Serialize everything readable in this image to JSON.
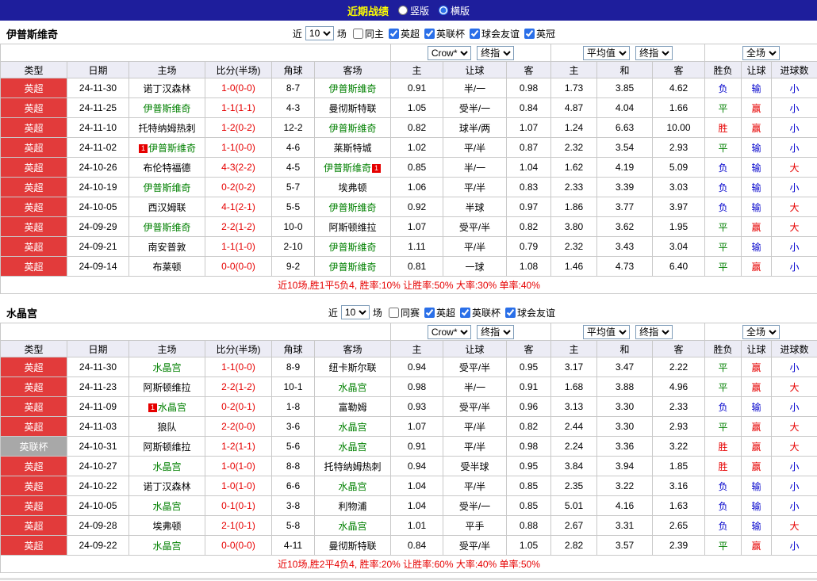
{
  "topbar": {
    "title": "近期战绩",
    "layout_options": [
      {
        "label": "竖版",
        "selected": false
      },
      {
        "label": "横版",
        "selected": true
      }
    ]
  },
  "colors": {
    "topbar_bg": "#1e1e9c",
    "title_yellow": "#ffff00",
    "league_premier_bg": "#e23b3b",
    "league_cup_bg": "#a8a8a8",
    "team_green": "#008000",
    "score": "#e60000",
    "win": "#e60000",
    "draw": "#008000",
    "loss": "#0000cc",
    "cover": "#e60000",
    "fail": "#0000cc",
    "over": "#e60000",
    "under": "#0000cc",
    "summary": "#e60000"
  },
  "sections": [
    {
      "team": "伊普斯维奇",
      "filter": {
        "near": "近",
        "count": "10",
        "unit": "场",
        "checkboxes": [
          {
            "label": "同主",
            "checked": false
          },
          {
            "label": "英超",
            "checked": true
          },
          {
            "label": "英联杯",
            "checked": true
          },
          {
            "label": "球会友谊",
            "checked": true
          },
          {
            "label": "英冠",
            "checked": true
          }
        ]
      },
      "selects": {
        "bookmaker": "Crow*",
        "asia_time": "终指",
        "euro_type": "平均值",
        "euro_time": "终指",
        "scope": "全场"
      },
      "columns": [
        "类型",
        "日期",
        "主场",
        "比分(半场)",
        "角球",
        "客场",
        "主",
        "让球",
        "客",
        "主",
        "和",
        "客",
        "胜负",
        "让球",
        "进球数"
      ],
      "rows": [
        {
          "type": "英超",
          "league": "premier",
          "date": "24-11-30",
          "home": {
            "name": "诺丁汉森林",
            "team": false
          },
          "score": "1-0(0-0)",
          "corners": "8-7",
          "away": {
            "name": "伊普斯维奇",
            "team": true
          },
          "asia": [
            "0.91",
            "半/一",
            "0.98"
          ],
          "euro": [
            "1.73",
            "3.85",
            "4.62"
          ],
          "result": "负",
          "handicap": "输",
          "goals": "小"
        },
        {
          "type": "英超",
          "league": "premier",
          "date": "24-11-25",
          "home": {
            "name": "伊普斯维奇",
            "team": true
          },
          "score": "1-1(1-1)",
          "corners": "4-3",
          "away": {
            "name": "曼彻斯特联",
            "team": false
          },
          "asia": [
            "1.05",
            "受半/一",
            "0.84"
          ],
          "euro": [
            "4.87",
            "4.04",
            "1.66"
          ],
          "result": "平",
          "handicap": "赢",
          "goals": "小"
        },
        {
          "type": "英超",
          "league": "premier",
          "date": "24-11-10",
          "home": {
            "name": "托特纳姆热刺",
            "team": false
          },
          "score": "1-2(0-2)",
          "corners": "12-2",
          "away": {
            "name": "伊普斯维奇",
            "team": true
          },
          "asia": [
            "0.82",
            "球半/两",
            "1.07"
          ],
          "euro": [
            "1.24",
            "6.63",
            "10.00"
          ],
          "result": "胜",
          "handicap": "赢",
          "goals": "小"
        },
        {
          "type": "英超",
          "league": "premier",
          "date": "24-11-02",
          "home": {
            "name": "伊普斯维奇",
            "team": true,
            "badge_pre": "1"
          },
          "score": "1-1(0-0)",
          "corners": "4-6",
          "away": {
            "name": "莱斯特城",
            "team": false
          },
          "asia": [
            "1.02",
            "平/半",
            "0.87"
          ],
          "euro": [
            "2.32",
            "3.54",
            "2.93"
          ],
          "result": "平",
          "handicap": "输",
          "goals": "小"
        },
        {
          "type": "英超",
          "league": "premier",
          "date": "24-10-26",
          "home": {
            "name": "布伦特福德",
            "team": false
          },
          "score": "4-3(2-2)",
          "corners": "4-5",
          "away": {
            "name": "伊普斯维奇",
            "team": true,
            "badge_post": "1"
          },
          "asia": [
            "0.85",
            "半/一",
            "1.04"
          ],
          "euro": [
            "1.62",
            "4.19",
            "5.09"
          ],
          "result": "负",
          "handicap": "输",
          "goals": "大"
        },
        {
          "type": "英超",
          "league": "premier",
          "date": "24-10-19",
          "home": {
            "name": "伊普斯维奇",
            "team": true
          },
          "score": "0-2(0-2)",
          "corners": "5-7",
          "away": {
            "name": "埃弗顿",
            "team": false
          },
          "asia": [
            "1.06",
            "平/半",
            "0.83"
          ],
          "euro": [
            "2.33",
            "3.39",
            "3.03"
          ],
          "result": "负",
          "handicap": "输",
          "goals": "小"
        },
        {
          "type": "英超",
          "league": "premier",
          "date": "24-10-05",
          "home": {
            "name": "西汉姆联",
            "team": false
          },
          "score": "4-1(2-1)",
          "corners": "5-5",
          "away": {
            "name": "伊普斯维奇",
            "team": true
          },
          "asia": [
            "0.92",
            "半球",
            "0.97"
          ],
          "euro": [
            "1.86",
            "3.77",
            "3.97"
          ],
          "result": "负",
          "handicap": "输",
          "goals": "大"
        },
        {
          "type": "英超",
          "league": "premier",
          "date": "24-09-29",
          "home": {
            "name": "伊普斯维奇",
            "team": true
          },
          "score": "2-2(1-2)",
          "corners": "10-0",
          "away": {
            "name": "阿斯顿维拉",
            "team": false
          },
          "asia": [
            "1.07",
            "受平/半",
            "0.82"
          ],
          "euro": [
            "3.80",
            "3.62",
            "1.95"
          ],
          "result": "平",
          "handicap": "赢",
          "goals": "大"
        },
        {
          "type": "英超",
          "league": "premier",
          "date": "24-09-21",
          "home": {
            "name": "南安普敦",
            "team": false
          },
          "score": "1-1(1-0)",
          "corners": "2-10",
          "away": {
            "name": "伊普斯维奇",
            "team": true
          },
          "asia": [
            "1.11",
            "平/半",
            "0.79"
          ],
          "euro": [
            "2.32",
            "3.43",
            "3.04"
          ],
          "result": "平",
          "handicap": "输",
          "goals": "小"
        },
        {
          "type": "英超",
          "league": "premier",
          "date": "24-09-14",
          "home": {
            "name": "布莱顿",
            "team": false
          },
          "score": "0-0(0-0)",
          "corners": "9-2",
          "away": {
            "name": "伊普斯维奇",
            "team": true
          },
          "asia": [
            "0.81",
            "一球",
            "1.08"
          ],
          "euro": [
            "1.46",
            "4.73",
            "6.40"
          ],
          "result": "平",
          "handicap": "赢",
          "goals": "小"
        }
      ],
      "summary": "近10场,胜1平5负4, 胜率:10% 让胜率:50% 大率:30% 单率:40%"
    },
    {
      "team": "水晶宫",
      "filter": {
        "near": "近",
        "count": "10",
        "unit": "场",
        "checkboxes": [
          {
            "label": "同赛",
            "checked": false
          },
          {
            "label": "英超",
            "checked": true
          },
          {
            "label": "英联杯",
            "checked": true
          },
          {
            "label": "球会友谊",
            "checked": true
          }
        ]
      },
      "selects": {
        "bookmaker": "Crow*",
        "asia_time": "终指",
        "euro_type": "平均值",
        "euro_time": "终指",
        "scope": "全场"
      },
      "columns": [
        "类型",
        "日期",
        "主场",
        "比分(半场)",
        "角球",
        "客场",
        "主",
        "让球",
        "客",
        "主",
        "和",
        "客",
        "胜负",
        "让球",
        "进球数"
      ],
      "rows": [
        {
          "type": "英超",
          "league": "premier",
          "date": "24-11-30",
          "home": {
            "name": "水晶宫",
            "team": true
          },
          "score": "1-1(0-0)",
          "corners": "8-9",
          "away": {
            "name": "纽卡斯尔联",
            "team": false
          },
          "asia": [
            "0.94",
            "受平/半",
            "0.95"
          ],
          "euro": [
            "3.17",
            "3.47",
            "2.22"
          ],
          "result": "平",
          "handicap": "赢",
          "goals": "小"
        },
        {
          "type": "英超",
          "league": "premier",
          "date": "24-11-23",
          "home": {
            "name": "阿斯顿维拉",
            "team": false
          },
          "score": "2-2(1-2)",
          "corners": "10-1",
          "away": {
            "name": "水晶宫",
            "team": true
          },
          "asia": [
            "0.98",
            "半/一",
            "0.91"
          ],
          "euro": [
            "1.68",
            "3.88",
            "4.96"
          ],
          "result": "平",
          "handicap": "赢",
          "goals": "大"
        },
        {
          "type": "英超",
          "league": "premier",
          "date": "24-11-09",
          "home": {
            "name": "水晶宫",
            "team": true,
            "badge_pre": "1"
          },
          "score": "0-2(0-1)",
          "corners": "1-8",
          "away": {
            "name": "富勒姆",
            "team": false
          },
          "asia": [
            "0.93",
            "受平/半",
            "0.96"
          ],
          "euro": [
            "3.13",
            "3.30",
            "2.33"
          ],
          "result": "负",
          "handicap": "输",
          "goals": "小"
        },
        {
          "type": "英超",
          "league": "premier",
          "date": "24-11-03",
          "home": {
            "name": "狼队",
            "team": false
          },
          "score": "2-2(0-0)",
          "corners": "3-6",
          "away": {
            "name": "水晶宫",
            "team": true
          },
          "asia": [
            "1.07",
            "平/半",
            "0.82"
          ],
          "euro": [
            "2.44",
            "3.30",
            "2.93"
          ],
          "result": "平",
          "handicap": "赢",
          "goals": "大"
        },
        {
          "type": "英联杯",
          "league": "cup",
          "date": "24-10-31",
          "home": {
            "name": "阿斯顿维拉",
            "team": false
          },
          "score": "1-2(1-1)",
          "corners": "5-6",
          "away": {
            "name": "水晶宫",
            "team": true
          },
          "asia": [
            "0.91",
            "平/半",
            "0.98"
          ],
          "euro": [
            "2.24",
            "3.36",
            "3.22"
          ],
          "result": "胜",
          "handicap": "赢",
          "goals": "大"
        },
        {
          "type": "英超",
          "league": "premier",
          "date": "24-10-27",
          "home": {
            "name": "水晶宫",
            "team": true
          },
          "score": "1-0(1-0)",
          "corners": "8-8",
          "away": {
            "name": "托特纳姆热刺",
            "team": false
          },
          "asia": [
            "0.94",
            "受半球",
            "0.95"
          ],
          "euro": [
            "3.84",
            "3.94",
            "1.85"
          ],
          "result": "胜",
          "handicap": "赢",
          "goals": "小"
        },
        {
          "type": "英超",
          "league": "premier",
          "date": "24-10-22",
          "home": {
            "name": "诺丁汉森林",
            "team": false
          },
          "score": "1-0(1-0)",
          "corners": "6-6",
          "away": {
            "name": "水晶宫",
            "team": true
          },
          "asia": [
            "1.04",
            "平/半",
            "0.85"
          ],
          "euro": [
            "2.35",
            "3.22",
            "3.16"
          ],
          "result": "负",
          "handicap": "输",
          "goals": "小"
        },
        {
          "type": "英超",
          "league": "premier",
          "date": "24-10-05",
          "home": {
            "name": "水晶宫",
            "team": true
          },
          "score": "0-1(0-1)",
          "corners": "3-8",
          "away": {
            "name": "利物浦",
            "team": false
          },
          "asia": [
            "1.04",
            "受半/一",
            "0.85"
          ],
          "euro": [
            "5.01",
            "4.16",
            "1.63"
          ],
          "result": "负",
          "handicap": "输",
          "goals": "小"
        },
        {
          "type": "英超",
          "league": "premier",
          "date": "24-09-28",
          "home": {
            "name": "埃弗顿",
            "team": false
          },
          "score": "2-1(0-1)",
          "corners": "5-8",
          "away": {
            "name": "水晶宫",
            "team": true
          },
          "asia": [
            "1.01",
            "平手",
            "0.88"
          ],
          "euro": [
            "2.67",
            "3.31",
            "2.65"
          ],
          "result": "负",
          "handicap": "输",
          "goals": "大"
        },
        {
          "type": "英超",
          "league": "premier",
          "date": "24-09-22",
          "home": {
            "name": "水晶宫",
            "team": true
          },
          "score": "0-0(0-0)",
          "corners": "4-11",
          "away": {
            "name": "曼彻斯特联",
            "team": false
          },
          "asia": [
            "0.84",
            "受平/半",
            "1.05"
          ],
          "euro": [
            "2.82",
            "3.57",
            "2.39"
          ],
          "result": "平",
          "handicap": "赢",
          "goals": "小"
        }
      ],
      "summary": "近10场,胜2平4负4, 胜率:20% 让胜率:60% 大率:40% 单率:50%"
    }
  ]
}
